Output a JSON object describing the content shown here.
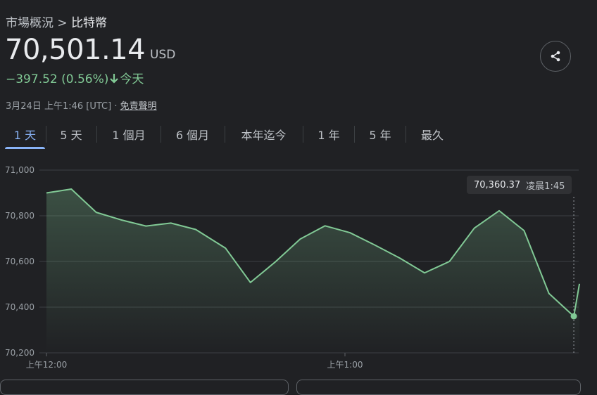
{
  "breadcrumb": {
    "parent": "市場概況",
    "separator": ">",
    "current": "比特幣"
  },
  "quote": {
    "price": "70,501.14",
    "currency": "USD",
    "change": "−397.52 (0.56%)",
    "change_period": "今天",
    "direction": "down"
  },
  "meta": {
    "timestamp": "3月24日 上午1:46 [UTC] · ",
    "disclaimer": "免責聲明"
  },
  "share": {
    "icon": "share-icon"
  },
  "tabs": [
    {
      "label": "1 天",
      "selected": true
    },
    {
      "label": "5 天"
    },
    {
      "label": "1 個月"
    },
    {
      "label": "6 個月"
    },
    {
      "label": "本年迄今"
    },
    {
      "label": "1 年"
    },
    {
      "label": "5 年"
    },
    {
      "label": "最久"
    }
  ],
  "tooltip": {
    "value": "70,360.37",
    "time": "凌晨1:45"
  },
  "colors": {
    "accent": "#8ab4f8",
    "line": "#81c995",
    "background": "#202124"
  },
  "chart_data": {
    "type": "area",
    "x_tick_labels": [
      "上午12:00",
      "上午1:00"
    ],
    "y_tick_labels": [
      "71,000",
      "70,800",
      "70,600",
      "70,400",
      "70,200"
    ],
    "ylim": [
      70200,
      71000
    ],
    "x_minutes_since_midnight": [
      0,
      5,
      10,
      15,
      20,
      25,
      30,
      36,
      41,
      46,
      51,
      56,
      61,
      66,
      71,
      76,
      81,
      86,
      91,
      96,
      101,
      106
    ],
    "values": [
      70900,
      70917,
      70815,
      70782,
      70755,
      70768,
      70740,
      70658,
      70508,
      70598,
      70698,
      70756,
      70726,
      70672,
      70615,
      70550,
      70600,
      70746,
      70822,
      70735,
      70460,
      70360
    ],
    "last_point_value": 70502,
    "grid": true
  }
}
